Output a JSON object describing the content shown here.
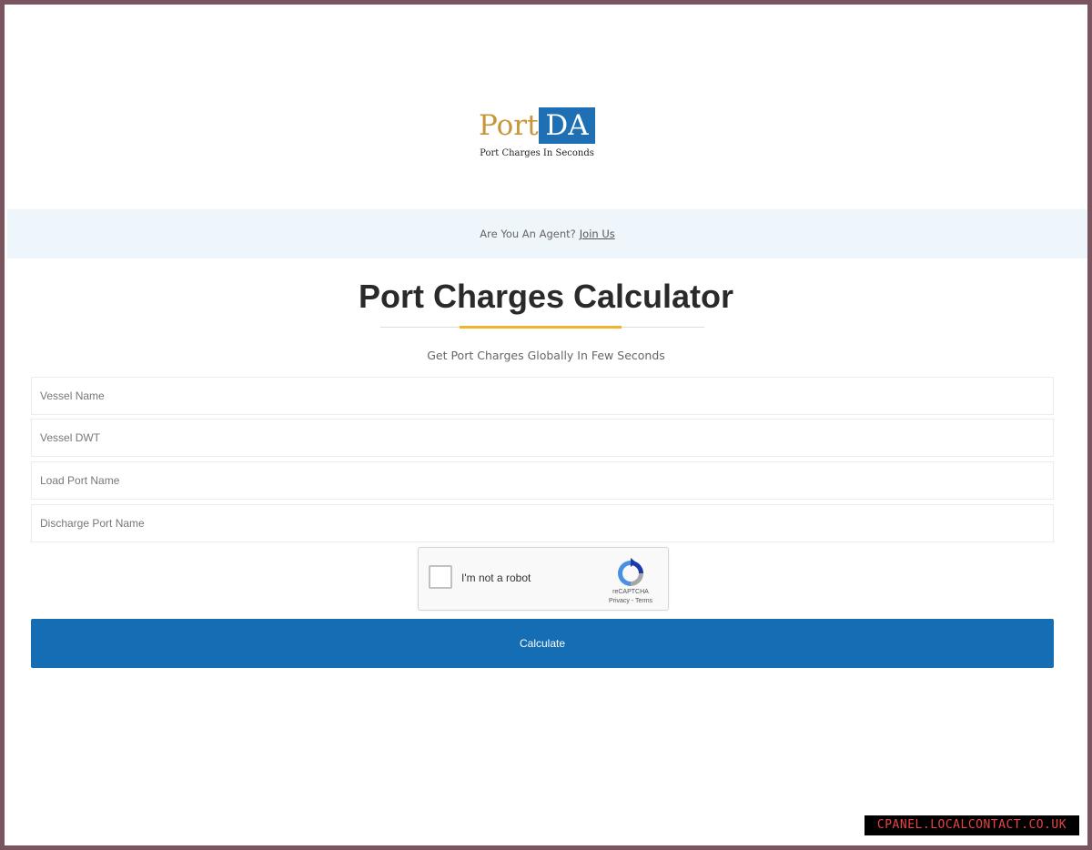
{
  "logo": {
    "word_port": "Port",
    "word_da": "DA",
    "tagline": "Port Charges In Seconds",
    "colors": {
      "port": "#c8963a",
      "da_background": "#1f6fb4"
    }
  },
  "agent_band": {
    "question": "Are You An Agent?",
    "link_label": "Join Us"
  },
  "page": {
    "title": "Port Charges Calculator",
    "subtitle": "Get Port Charges Globally In Few Seconds",
    "accent_color": "#f0b429"
  },
  "form": {
    "vessel_name": {
      "placeholder": "Vessel Name",
      "value": ""
    },
    "vessel_dwt": {
      "placeholder": "Vessel DWT",
      "value": ""
    },
    "load_port": {
      "placeholder": "Load Port Name",
      "value": ""
    },
    "discharge_port": {
      "placeholder": "Discharge Port Name",
      "value": ""
    }
  },
  "captcha": {
    "label": "I'm not a robot",
    "brand": "reCAPTCHA",
    "terms": "Privacy - Terms",
    "icon": "recaptcha-icon"
  },
  "actions": {
    "calculate_label": "Calculate",
    "button_color": "#156db3"
  },
  "watermark": {
    "text": "CPANEL.LOCALCONTACT.CO.UK"
  }
}
